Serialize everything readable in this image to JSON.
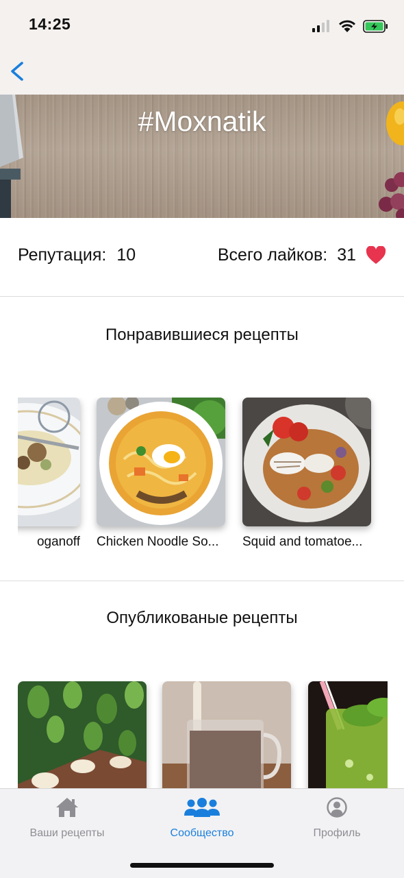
{
  "status_bar": {
    "time": "14:25"
  },
  "nav": {
    "back_icon": "chevron-left-icon"
  },
  "banner": {
    "title": "#Moxnatik"
  },
  "stats": {
    "reputation_label": "Репутация:",
    "reputation_value": "10",
    "likes_label": "Всего лайков:",
    "likes_value": "31",
    "heart_color": "#e8344e"
  },
  "liked": {
    "title": "Понравившиеся рецепты",
    "items": [
      {
        "label": "oganoff"
      },
      {
        "label": "Chicken Noodle So..."
      },
      {
        "label": "Squid and tomatoe..."
      }
    ]
  },
  "published": {
    "title": "Опубликованые рецепты",
    "items": [
      {
        "label": ""
      },
      {
        "label": ""
      },
      {
        "label": ""
      }
    ]
  },
  "tabs": [
    {
      "label": "Ваши рецепты",
      "icon": "home-icon",
      "active": false
    },
    {
      "label": "Сообщество",
      "icon": "community-icon",
      "active": true
    },
    {
      "label": "Профиль",
      "icon": "profile-icon",
      "active": false
    }
  ],
  "colors": {
    "accent": "#1a7fdc",
    "inactive": "#8e8e93"
  }
}
